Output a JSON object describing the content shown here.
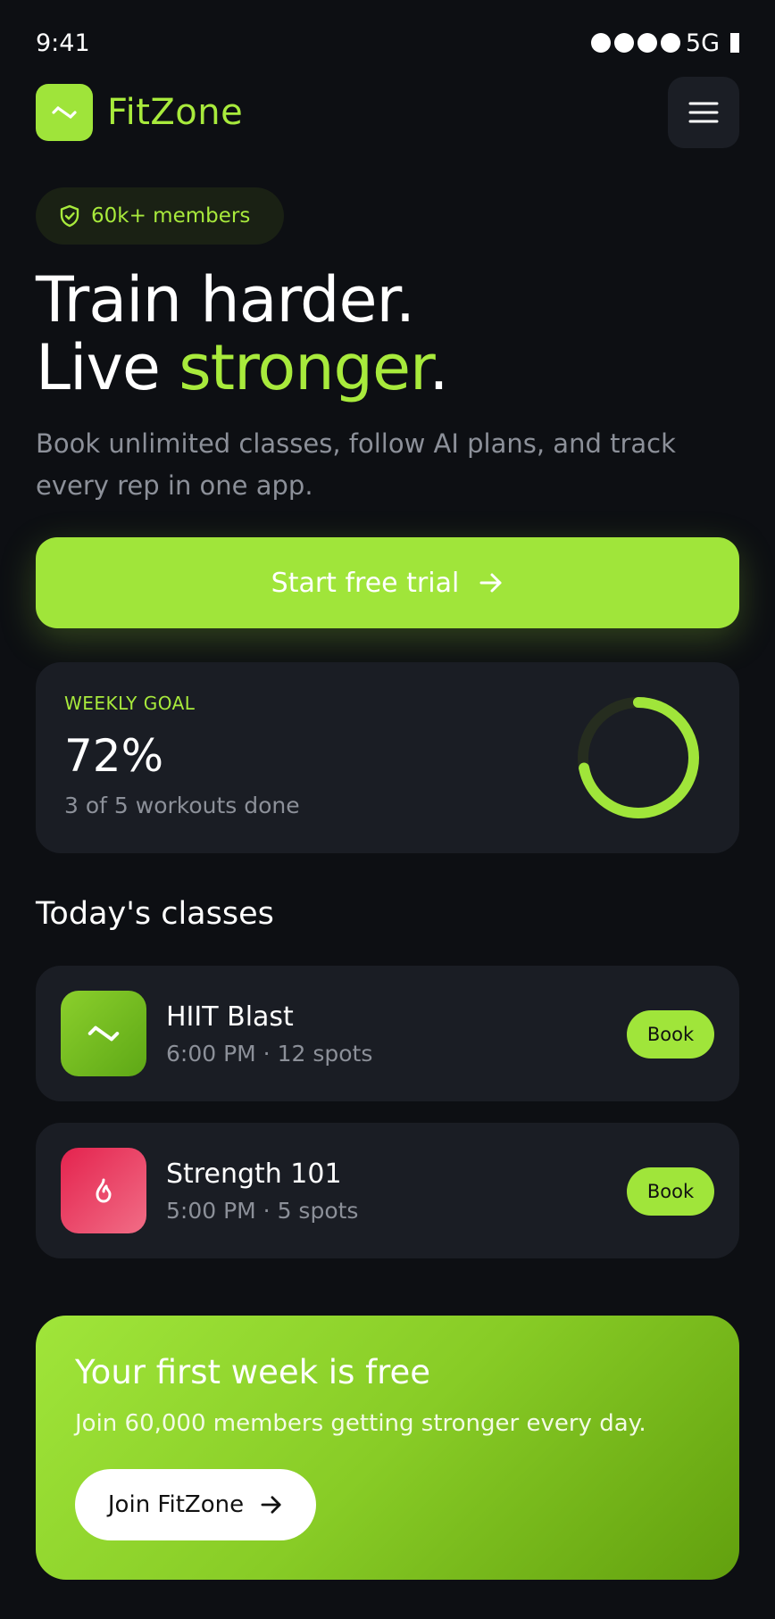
{
  "status_bar": {
    "time": "9:41",
    "network": "5G"
  },
  "brand": {
    "name": "FitZone",
    "logo_icon": "dumbbell-icon"
  },
  "header": {
    "menu_icon": "hamburger-menu-icon"
  },
  "members_pill": {
    "icon": "shield-check-icon",
    "label": "60k+ members"
  },
  "hero": {
    "title_line1": "Train harder.",
    "title_line2_plain": "Live ",
    "title_line2_accent": "stronger",
    "title_line2_end": ".",
    "subtitle": "Book unlimited classes, follow AI plans, and track every rep in one app."
  },
  "cta": {
    "label": "Start free trial",
    "icon": "arrow-right-icon"
  },
  "weekly_goal": {
    "label": "WEEKLY GOAL",
    "value": "72%",
    "progress": 0.72,
    "detail": "3 of 5 workouts done"
  },
  "classes_section": {
    "title": "Today's classes",
    "items": [
      {
        "name": "HIIT Blast",
        "meta": "6:00 PM · 12 spots",
        "icon": "dumbbell-icon",
        "book_label": "Book"
      },
      {
        "name": "Strength 101",
        "meta": "5:00 PM · 5 spots",
        "icon": "flame-icon",
        "book_label": "Book"
      }
    ]
  },
  "promo": {
    "title": "Your first week is free",
    "subtitle": "Join 60,000 members getting stronger every day.",
    "button_label": "Join FitZone",
    "button_icon": "arrow-right-icon"
  },
  "colors": {
    "accent": "#a8ea3c",
    "background": "#0d0f13",
    "card": "#1a1d24",
    "muted": "#8c9099",
    "red": "#e4234e"
  }
}
